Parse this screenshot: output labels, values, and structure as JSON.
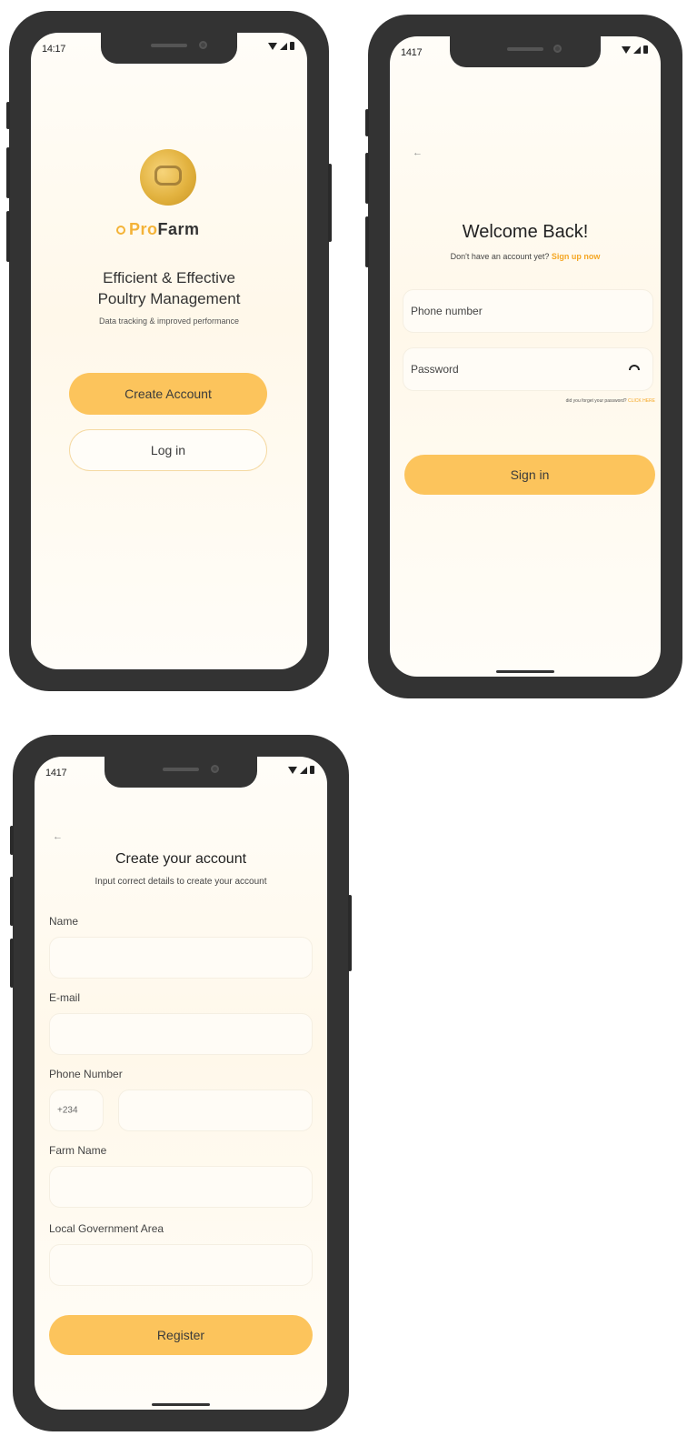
{
  "colors": {
    "accent": "#fcc45c",
    "frame": "#333333",
    "brand_orange": "#f4b338",
    "link_orange": "#f5a623"
  },
  "status_time": "14:17",
  "status_time_alt": "1417",
  "screen1": {
    "brand_pro": "Pro",
    "brand_farm": "Farm",
    "headline_line1": "Efficient & Effective",
    "headline_line2": "Poultry Management",
    "subtitle": "Data tracking & improved performance",
    "create_account": "Create Account",
    "login": "Log in"
  },
  "screen2": {
    "back": "←",
    "title": "Welcome Back!",
    "no_account": "Don't have an account yet?",
    "signup": "Sign up now",
    "phone_placeholder": "Phone number",
    "password_placeholder": "Password",
    "forgot": "did you forget your password?",
    "click_here": "CLICK HERE",
    "sign_in": "Sign in"
  },
  "screen3": {
    "back": "←",
    "title": "Create your account",
    "subtitle": "Input correct details to create your account",
    "name_label": "Name",
    "email_label": "E-mail",
    "phone_label": "Phone Number",
    "country_code": "+234",
    "farm_label": "Farm Name",
    "lga_label": "Local Government Area",
    "register": "Register"
  }
}
